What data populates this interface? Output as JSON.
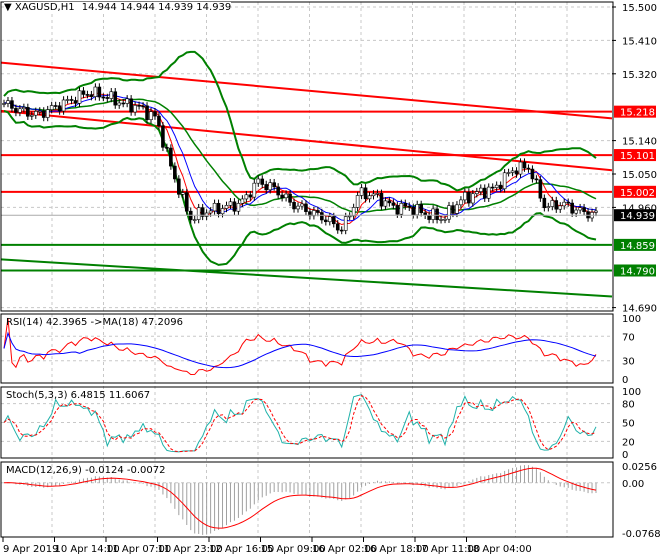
{
  "header": {
    "symbol": "XAGUSD,H1",
    "ohlc": "14.944 14.944 14.939 14.939"
  },
  "colors": {
    "up": "#0000ff",
    "down": "#ff0000",
    "bands": "#008000",
    "red_line": "#ff0000",
    "green_line": "#008000",
    "rsi": "#ff0000",
    "rsi_ma": "#0000ff",
    "stoch_main": "#20b2aa",
    "stoch_signal": "#ff0000",
    "macd": "#ff0000",
    "macd_hist": "#a0a0a0"
  },
  "chart_data": [
    {
      "type": "candlestick",
      "title": "XAGUSD,H1",
      "ylim": [
        14.66,
        15.52
      ],
      "yticks": [
        "15.500",
        "15.410",
        "15.320",
        "15.140",
        "15.050",
        "14.960",
        "14.690"
      ],
      "yvals": [
        15.5,
        15.41,
        15.32,
        15.14,
        15.05,
        14.96,
        14.69
      ],
      "xticks": [
        "9 Apr 2019",
        "10 Apr 14:00",
        "11 Apr 07:00",
        "11 Apr 23:00",
        "12 Apr 16:00",
        "15 Apr 09:00",
        "16 Apr 02:00",
        "16 Apr 18:00",
        "17 Apr 11:00",
        "18 Apr 04:00"
      ],
      "close_anchors": [
        15.24,
        15.22,
        15.21,
        15.23,
        15.25,
        15.27,
        15.26,
        15.24,
        15.23,
        15.2,
        15.05,
        14.93,
        14.95,
        14.96,
        14.97,
        15.03,
        15.01,
        14.97,
        14.95,
        14.93,
        14.9,
        15.0,
        14.99,
        14.96,
        14.96,
        14.94,
        14.93,
        14.98,
        15.0,
        15.01,
        15.06,
        15.07,
        14.96,
        14.97,
        14.95,
        14.94
      ],
      "levels": [
        {
          "label": "15.218",
          "value": 15.218,
          "color": "#ff0000"
        },
        {
          "label": "15.101",
          "value": 15.101,
          "color": "#ff0000"
        },
        {
          "label": "15.002",
          "value": 15.002,
          "color": "#ff0000"
        },
        {
          "label": "14.859",
          "value": 14.859,
          "color": "#008000"
        },
        {
          "label": "14.790",
          "value": 14.79,
          "color": "#008000"
        }
      ],
      "current": {
        "label": "14.939",
        "value": 14.939
      },
      "trendlines": [
        {
          "color": "#ff0000",
          "from": 15.35,
          "to": 15.2
        },
        {
          "color": "#ff0000",
          "from": 15.22,
          "to": 15.06
        },
        {
          "color": "#008000",
          "from": 14.82,
          "to": 14.72
        }
      ]
    },
    {
      "type": "line",
      "title": "RSI(14) 42.3965  ->MA(18) 47.2096",
      "yticks": [
        "100",
        "70",
        "30",
        "0"
      ],
      "yvals": [
        100,
        70,
        30,
        0
      ]
    },
    {
      "type": "line",
      "title": "Stoch(5,3,3) 6.4815 11.6067",
      "yticks": [
        "100",
        "80",
        "50",
        "20",
        "0"
      ],
      "yvals": [
        100,
        80,
        50,
        20,
        0
      ]
    },
    {
      "type": "bar",
      "title": "MACD(12,26,9) -0.0124 -0.0072",
      "yticks": [
        "0.0256",
        "0.00",
        "-0.0768"
      ],
      "yvals": [
        0.0256,
        0,
        -0.0768
      ]
    }
  ]
}
